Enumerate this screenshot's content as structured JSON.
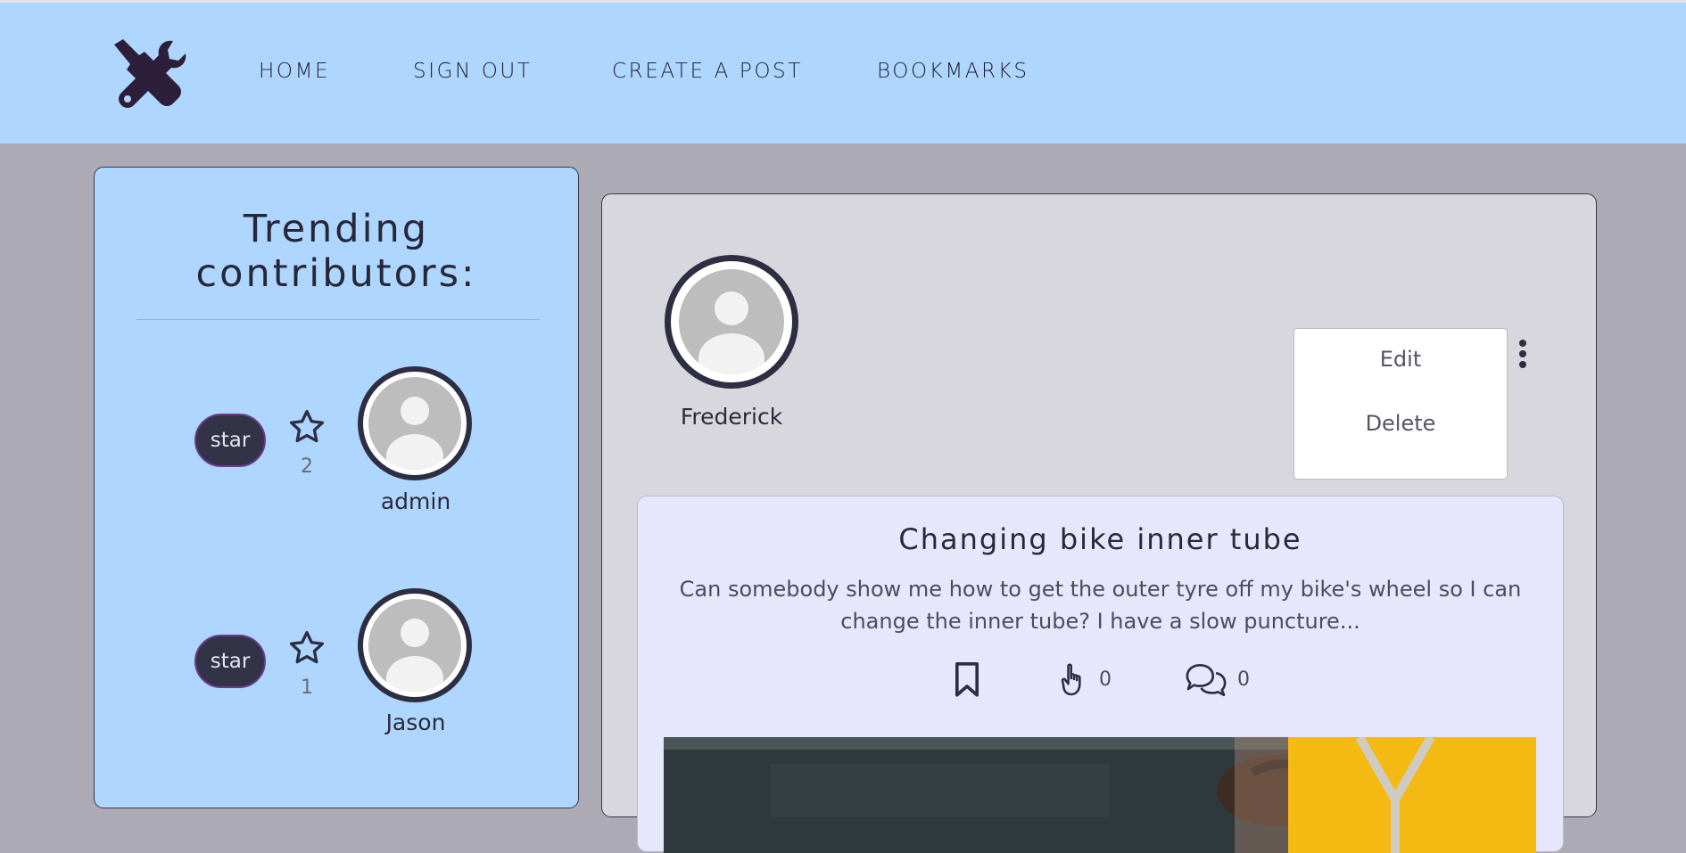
{
  "nav": {
    "items": [
      {
        "label": "HOME"
      },
      {
        "label": "SIGN OUT"
      },
      {
        "label": "CREATE A POST"
      },
      {
        "label": "BOOKMARKS"
      }
    ]
  },
  "sidebar": {
    "title_line1": "Trending",
    "title_line2": "contributors:",
    "contributors": [
      {
        "star_label": "star",
        "stars": "2",
        "name": "admin"
      },
      {
        "star_label": "star",
        "stars": "1",
        "name": "Jason"
      }
    ]
  },
  "post": {
    "author": "Frederick",
    "menu": {
      "edit": "Edit",
      "delete": "Delete"
    },
    "title": "Changing bike inner tube",
    "body": "Can somebody show me how to get the outer tyre off my bike's wheel so I can change the inner tube? I have a slow puncture...",
    "likes": "0",
    "comments": "0"
  },
  "colors": {
    "header_bg": "#aed6fe",
    "page_bg": "#acaab4",
    "card_bg": "#e6e6fd",
    "accent_dark": "#2e2e42"
  },
  "icons": [
    "tools-logo-icon",
    "star-outline-icon",
    "avatar-placeholder-icon",
    "kebab-menu-icon",
    "bookmark-icon",
    "hand-pointing-icon",
    "comments-icon"
  ]
}
